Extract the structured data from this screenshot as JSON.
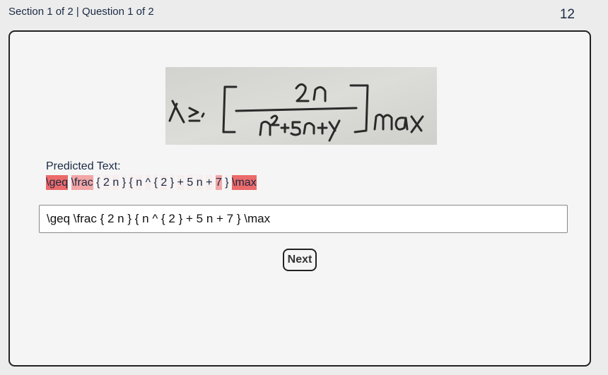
{
  "header": {
    "progress": "Section 1 of 2 | Question 1 of 2",
    "counter": "12"
  },
  "image": {
    "alt": "handwritten math expression"
  },
  "predicted": {
    "label": "Predicted Text:",
    "tokens": [
      "\\geq",
      "\\frac",
      "{",
      "2",
      "n",
      "}",
      "{",
      "n",
      "^",
      "{",
      "2",
      "}",
      "+",
      "5",
      "n",
      "+",
      "7",
      "}",
      "\\max"
    ]
  },
  "answer": {
    "value": "\\geq \\frac { 2 n } { n ^ { 2 } + 5 n + 7 } \\max"
  },
  "next_label": "Next",
  "colors": {
    "high_confidence_issue": "#eb6a6a",
    "mid_confidence_issue": "#f3a6a6",
    "low_highlight": "#fbe9e9",
    "text": "#1a2a44"
  }
}
